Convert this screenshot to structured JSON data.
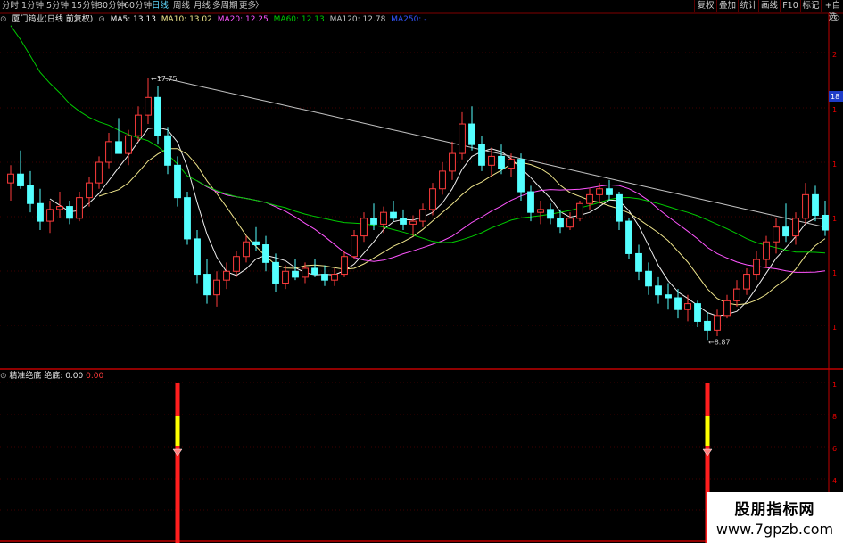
{
  "toolbar": {
    "periods": [
      "分时",
      "1分钟",
      "5分钟",
      "15分钟",
      "30分钟",
      "60分钟",
      "日线",
      "周线",
      "月线",
      "多周期",
      "更多"
    ],
    "active_period": "日线",
    "more_arrow": "〉",
    "right_buttons": [
      "复权",
      "叠加",
      "统计",
      "画线",
      "F10",
      "标记",
      "+自选"
    ]
  },
  "legend": {
    "title": "厦门钨业(日线 前复权)",
    "ma5": "MA5: 13.13",
    "ma10": "MA10: 13.02",
    "ma20": "MA20: 12.25",
    "ma60": "MA60: 12.13",
    "ma120": "MA120: 12.78",
    "ma250": "MA250: -"
  },
  "sub_legend": {
    "title": "精准绝底",
    "label": "绝底: 0.00",
    "value": "0.00"
  },
  "annotations": {
    "high": "17.75",
    "low": "8.87"
  },
  "right_axis": {
    "main_ticks": [
      "2",
      "1",
      "1",
      "1",
      "1",
      "1",
      "1"
    ],
    "price_badge": "18",
    "sub_ticks": [
      "1",
      "8",
      "6",
      "4"
    ]
  },
  "colors": {
    "up": "#ff3c3c",
    "down": "#54ffff",
    "ma5": "#f0f0f0",
    "ma10": "#f0e68c",
    "ma20": "#ff55ff",
    "ma60": "#00cc00",
    "ma120": "#c0c0c0",
    "ma250": "#3355ff",
    "signal_red": "#ff1e1e",
    "signal_yellow": "#ffff00",
    "grid": "#800000"
  },
  "watermark": {
    "top": "股朋指标网",
    "bottom": "www.7gpzb.com"
  },
  "chart_data": {
    "type": "candlestick",
    "price_range": [
      8.0,
      19.5
    ],
    "candles": [
      [
        14.2,
        14.8,
        13.6,
        14.5
      ],
      [
        14.5,
        15.3,
        14.0,
        14.1
      ],
      [
        14.1,
        14.6,
        13.2,
        13.5
      ],
      [
        13.5,
        14.0,
        12.6,
        12.9
      ],
      [
        12.9,
        13.6,
        12.5,
        13.3
      ],
      [
        13.3,
        13.9,
        13.0,
        13.4
      ],
      [
        13.4,
        13.6,
        12.8,
        13.0
      ],
      [
        13.0,
        13.9,
        12.9,
        13.7
      ],
      [
        13.7,
        14.4,
        13.4,
        14.2
      ],
      [
        14.2,
        15.1,
        14.0,
        14.9
      ],
      [
        14.9,
        15.9,
        14.7,
        15.6
      ],
      [
        15.6,
        16.4,
        15.2,
        15.2
      ],
      [
        15.2,
        16.0,
        14.8,
        15.8
      ],
      [
        15.8,
        16.8,
        15.6,
        16.5
      ],
      [
        16.5,
        17.75,
        16.2,
        17.1
      ],
      [
        17.1,
        17.5,
        15.5,
        15.8
      ],
      [
        15.8,
        16.1,
        14.5,
        14.8
      ],
      [
        14.8,
        15.1,
        13.4,
        13.7
      ],
      [
        13.7,
        13.9,
        12.1,
        12.3
      ],
      [
        12.3,
        12.6,
        10.8,
        11.1
      ],
      [
        11.1,
        11.6,
        10.1,
        10.4
      ],
      [
        10.4,
        11.2,
        10.0,
        10.9
      ],
      [
        10.9,
        11.5,
        10.6,
        11.2
      ],
      [
        11.2,
        11.9,
        11.0,
        11.7
      ],
      [
        11.7,
        12.4,
        11.5,
        12.2
      ],
      [
        12.2,
        12.7,
        11.9,
        12.1
      ],
      [
        12.1,
        12.4,
        11.2,
        11.5
      ],
      [
        11.5,
        11.8,
        10.5,
        10.8
      ],
      [
        10.8,
        11.4,
        10.6,
        11.2
      ],
      [
        11.2,
        11.6,
        10.9,
        11.0
      ],
      [
        11.0,
        11.5,
        10.8,
        11.3
      ],
      [
        11.3,
        11.6,
        11.0,
        11.1
      ],
      [
        11.1,
        11.4,
        10.7,
        10.9
      ],
      [
        10.9,
        11.3,
        10.7,
        11.1
      ],
      [
        11.1,
        11.9,
        11.0,
        11.7
      ],
      [
        11.7,
        12.6,
        11.6,
        12.4
      ],
      [
        12.4,
        13.2,
        12.2,
        13.0
      ],
      [
        13.0,
        13.5,
        12.6,
        12.8
      ],
      [
        12.8,
        13.4,
        12.5,
        13.2
      ],
      [
        13.2,
        13.6,
        12.9,
        13.0
      ],
      [
        13.0,
        13.3,
        12.6,
        12.8
      ],
      [
        12.8,
        13.1,
        12.4,
        12.9
      ],
      [
        12.9,
        13.5,
        12.7,
        13.3
      ],
      [
        13.3,
        14.2,
        13.1,
        14.0
      ],
      [
        14.0,
        14.9,
        13.8,
        14.6
      ],
      [
        14.6,
        15.6,
        14.3,
        15.2
      ],
      [
        15.2,
        16.6,
        15.0,
        16.2
      ],
      [
        16.2,
        16.8,
        15.3,
        15.5
      ],
      [
        15.5,
        15.8,
        14.6,
        14.8
      ],
      [
        14.8,
        15.4,
        14.4,
        15.1
      ],
      [
        15.1,
        15.5,
        14.5,
        14.7
      ],
      [
        14.7,
        15.2,
        14.4,
        15.0
      ],
      [
        15.0,
        15.2,
        13.6,
        13.9
      ],
      [
        13.9,
        14.1,
        12.9,
        13.2
      ],
      [
        13.2,
        13.6,
        12.8,
        13.3
      ],
      [
        13.3,
        13.5,
        12.8,
        13.0
      ],
      [
        13.0,
        13.3,
        12.5,
        12.7
      ],
      [
        12.7,
        13.2,
        12.6,
        13.0
      ],
      [
        13.0,
        13.6,
        12.9,
        13.5
      ],
      [
        13.5,
        14.0,
        13.3,
        13.8
      ],
      [
        13.8,
        14.2,
        13.5,
        14.0
      ],
      [
        14.0,
        14.3,
        13.6,
        13.8
      ],
      [
        13.8,
        13.9,
        12.6,
        12.9
      ],
      [
        12.9,
        13.0,
        11.6,
        11.8
      ],
      [
        11.8,
        12.1,
        10.9,
        11.2
      ],
      [
        11.2,
        11.5,
        10.4,
        10.7
      ],
      [
        10.7,
        11.0,
        10.1,
        10.4
      ],
      [
        10.4,
        10.8,
        9.9,
        10.3
      ],
      [
        10.3,
        10.6,
        9.6,
        9.9
      ],
      [
        9.9,
        10.4,
        9.5,
        10.1
      ],
      [
        10.1,
        10.2,
        9.3,
        9.5
      ],
      [
        9.5,
        9.8,
        8.87,
        9.2
      ],
      [
        9.2,
        9.9,
        9.0,
        9.7
      ],
      [
        9.7,
        10.4,
        9.6,
        10.2
      ],
      [
        10.2,
        10.9,
        10.0,
        10.6
      ],
      [
        10.6,
        11.3,
        10.4,
        11.1
      ],
      [
        11.1,
        11.9,
        10.9,
        11.6
      ],
      [
        11.6,
        12.4,
        11.3,
        12.2
      ],
      [
        12.2,
        13.0,
        11.8,
        12.7
      ],
      [
        12.7,
        13.5,
        12.2,
        12.4
      ],
      [
        12.4,
        13.2,
        12.1,
        13.0
      ],
      [
        13.0,
        14.2,
        12.8,
        13.8
      ],
      [
        13.8,
        14.1,
        12.9,
        13.1
      ],
      [
        13.1,
        13.6,
        12.4,
        12.6
      ]
    ],
    "signals": [
      {
        "index": 17
      },
      {
        "index": 71
      }
    ]
  }
}
